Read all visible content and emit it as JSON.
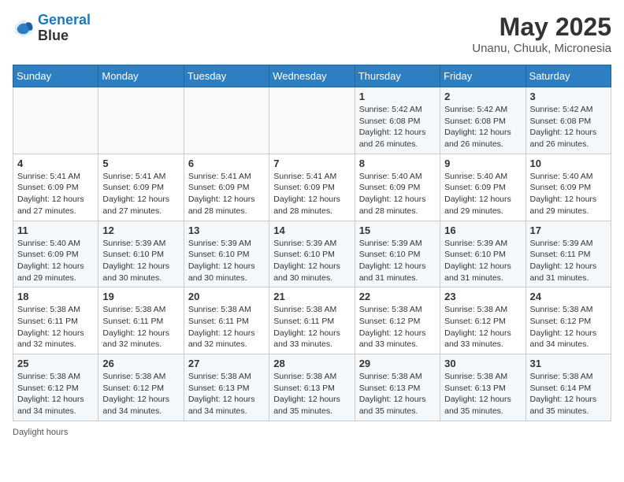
{
  "header": {
    "logo_line1": "General",
    "logo_line2": "Blue",
    "month": "May 2025",
    "location": "Unanu, Chuuk, Micronesia"
  },
  "weekdays": [
    "Sunday",
    "Monday",
    "Tuesday",
    "Wednesday",
    "Thursday",
    "Friday",
    "Saturday"
  ],
  "footer": "Daylight hours",
  "weeks": [
    [
      {
        "day": "",
        "info": ""
      },
      {
        "day": "",
        "info": ""
      },
      {
        "day": "",
        "info": ""
      },
      {
        "day": "",
        "info": ""
      },
      {
        "day": "1",
        "info": "Sunrise: 5:42 AM\nSunset: 6:08 PM\nDaylight: 12 hours and 26 minutes."
      },
      {
        "day": "2",
        "info": "Sunrise: 5:42 AM\nSunset: 6:08 PM\nDaylight: 12 hours and 26 minutes."
      },
      {
        "day": "3",
        "info": "Sunrise: 5:42 AM\nSunset: 6:08 PM\nDaylight: 12 hours and 26 minutes."
      }
    ],
    [
      {
        "day": "4",
        "info": "Sunrise: 5:41 AM\nSunset: 6:09 PM\nDaylight: 12 hours and 27 minutes."
      },
      {
        "day": "5",
        "info": "Sunrise: 5:41 AM\nSunset: 6:09 PM\nDaylight: 12 hours and 27 minutes."
      },
      {
        "day": "6",
        "info": "Sunrise: 5:41 AM\nSunset: 6:09 PM\nDaylight: 12 hours and 28 minutes."
      },
      {
        "day": "7",
        "info": "Sunrise: 5:41 AM\nSunset: 6:09 PM\nDaylight: 12 hours and 28 minutes."
      },
      {
        "day": "8",
        "info": "Sunrise: 5:40 AM\nSunset: 6:09 PM\nDaylight: 12 hours and 28 minutes."
      },
      {
        "day": "9",
        "info": "Sunrise: 5:40 AM\nSunset: 6:09 PM\nDaylight: 12 hours and 29 minutes."
      },
      {
        "day": "10",
        "info": "Sunrise: 5:40 AM\nSunset: 6:09 PM\nDaylight: 12 hours and 29 minutes."
      }
    ],
    [
      {
        "day": "11",
        "info": "Sunrise: 5:40 AM\nSunset: 6:09 PM\nDaylight: 12 hours and 29 minutes."
      },
      {
        "day": "12",
        "info": "Sunrise: 5:39 AM\nSunset: 6:10 PM\nDaylight: 12 hours and 30 minutes."
      },
      {
        "day": "13",
        "info": "Sunrise: 5:39 AM\nSunset: 6:10 PM\nDaylight: 12 hours and 30 minutes."
      },
      {
        "day": "14",
        "info": "Sunrise: 5:39 AM\nSunset: 6:10 PM\nDaylight: 12 hours and 30 minutes."
      },
      {
        "day": "15",
        "info": "Sunrise: 5:39 AM\nSunset: 6:10 PM\nDaylight: 12 hours and 31 minutes."
      },
      {
        "day": "16",
        "info": "Sunrise: 5:39 AM\nSunset: 6:10 PM\nDaylight: 12 hours and 31 minutes."
      },
      {
        "day": "17",
        "info": "Sunrise: 5:39 AM\nSunset: 6:11 PM\nDaylight: 12 hours and 31 minutes."
      }
    ],
    [
      {
        "day": "18",
        "info": "Sunrise: 5:38 AM\nSunset: 6:11 PM\nDaylight: 12 hours and 32 minutes."
      },
      {
        "day": "19",
        "info": "Sunrise: 5:38 AM\nSunset: 6:11 PM\nDaylight: 12 hours and 32 minutes."
      },
      {
        "day": "20",
        "info": "Sunrise: 5:38 AM\nSunset: 6:11 PM\nDaylight: 12 hours and 32 minutes."
      },
      {
        "day": "21",
        "info": "Sunrise: 5:38 AM\nSunset: 6:11 PM\nDaylight: 12 hours and 33 minutes."
      },
      {
        "day": "22",
        "info": "Sunrise: 5:38 AM\nSunset: 6:12 PM\nDaylight: 12 hours and 33 minutes."
      },
      {
        "day": "23",
        "info": "Sunrise: 5:38 AM\nSunset: 6:12 PM\nDaylight: 12 hours and 33 minutes."
      },
      {
        "day": "24",
        "info": "Sunrise: 5:38 AM\nSunset: 6:12 PM\nDaylight: 12 hours and 34 minutes."
      }
    ],
    [
      {
        "day": "25",
        "info": "Sunrise: 5:38 AM\nSunset: 6:12 PM\nDaylight: 12 hours and 34 minutes."
      },
      {
        "day": "26",
        "info": "Sunrise: 5:38 AM\nSunset: 6:12 PM\nDaylight: 12 hours and 34 minutes."
      },
      {
        "day": "27",
        "info": "Sunrise: 5:38 AM\nSunset: 6:13 PM\nDaylight: 12 hours and 34 minutes."
      },
      {
        "day": "28",
        "info": "Sunrise: 5:38 AM\nSunset: 6:13 PM\nDaylight: 12 hours and 35 minutes."
      },
      {
        "day": "29",
        "info": "Sunrise: 5:38 AM\nSunset: 6:13 PM\nDaylight: 12 hours and 35 minutes."
      },
      {
        "day": "30",
        "info": "Sunrise: 5:38 AM\nSunset: 6:13 PM\nDaylight: 12 hours and 35 minutes."
      },
      {
        "day": "31",
        "info": "Sunrise: 5:38 AM\nSunset: 6:14 PM\nDaylight: 12 hours and 35 minutes."
      }
    ]
  ]
}
